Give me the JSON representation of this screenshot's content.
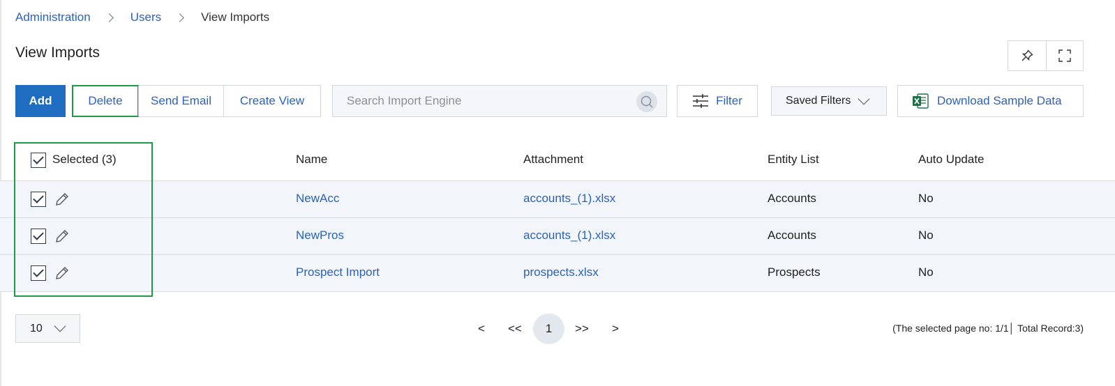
{
  "breadcrumb": {
    "items": [
      "Administration",
      "Users"
    ],
    "current": "View Imports"
  },
  "page": {
    "title": "View Imports"
  },
  "header_tools": {
    "pin_icon": "pin-icon",
    "fullscreen_icon": "fullscreen-icon"
  },
  "toolbar": {
    "add": "Add",
    "delete": "Delete",
    "send_email": "Send Email",
    "create_view": "Create View",
    "search_placeholder": "Search Import Engine",
    "filter": "Filter",
    "saved_filters": "Saved Filters",
    "download_sample": "Download Sample Data"
  },
  "table": {
    "headers": {
      "selected": "Selected (3)",
      "name": "Name",
      "attachment": "Attachment",
      "entity_list": "Entity List",
      "auto_update": "Auto Update"
    },
    "rows": [
      {
        "name": "NewAcc",
        "attachment": "accounts_(1).xlsx",
        "entity_list": "Accounts",
        "auto_update": "No",
        "checked": true
      },
      {
        "name": "NewPros",
        "attachment": "accounts_(1).xlsx",
        "entity_list": "Accounts",
        "auto_update": "No",
        "checked": true
      },
      {
        "name": "Prospect Import",
        "attachment": "prospects.xlsx",
        "entity_list": "Prospects",
        "auto_update": "No",
        "checked": true
      }
    ]
  },
  "pagination": {
    "page_size": "10",
    "prev": "<",
    "first": "<<",
    "current": "1",
    "last": ">>",
    "next": ">",
    "info": "(The selected page no: 1/1│ Total Record:3)"
  },
  "colors": {
    "accent": "#1f6dc1",
    "link": "#2b62b8",
    "highlight": "#1d9a43",
    "row_bg": "#f2f5f9"
  }
}
